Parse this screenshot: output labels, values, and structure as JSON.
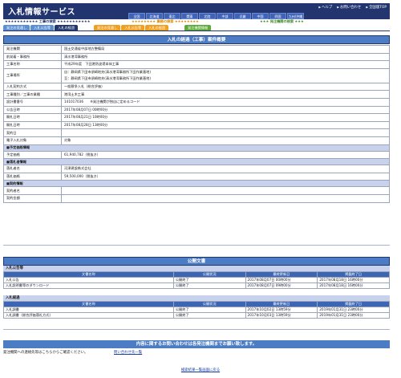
{
  "header": {
    "title": "入札情報サービス",
    "links": [
      "ヘルプ",
      "お問い合わせ",
      "全国版TOP"
    ],
    "regions": [
      "全国",
      "北海道",
      "東北",
      "関東",
      "北陸",
      "中部",
      "近畿",
      "中国",
      "四国",
      "九州/沖縄"
    ]
  },
  "categories": {
    "construction": "★★★★★★★★★★★ 工事の検索 ★★★★★★★★★★★",
    "services": "★★★★★★★★ 業務の検索 ★★★★★★★★",
    "client": "★★★ 発注機関の検索 ★★★"
  },
  "tabs": [
    "発注の見通し",
    "入札公告等",
    "入札の経過",
    "発注の見通し",
    "入札公告等",
    "入札の経過",
    "発注機関情報"
  ],
  "detail": {
    "title": "入札の経過（工事）案件概要",
    "rows": [
      {
        "k": "発注機関",
        "v": "国土交通省中部地方整備局"
      },
      {
        "k": "前発着・事務所",
        "v": "清水港湾事務所"
      },
      {
        "k": "工事名称",
        "v": "平成29年度　下田港防波堤本体工事"
      },
      {
        "k": "工事場所",
        "v1": "自：静岡県下田市須崎地先(清水港湾事務所下田作業基地)",
        "v2": "至：静岡県下田市須崎地先(清水港湾事務所下田作業基地)"
      },
      {
        "k": "入札契約方式",
        "v": "一般競争入札（総合評価）"
      },
      {
        "k": "工事種別／工事の業種",
        "v": "港湾土木工事"
      },
      {
        "k": "設計書番号",
        "v": "141017036　　※発注機関が独自に定めるコード"
      },
      {
        "k": "公告日時",
        "v": "2017年08月07日 00時00分"
      },
      {
        "k": "開札日時",
        "v": "2017年08月21日 10時00分"
      },
      {
        "k": "開札日時",
        "v": "2017年08月28日 13時00分"
      },
      {
        "k": "契約日",
        "v": ""
      },
      {
        "k": "電子入札対象",
        "v": "対象"
      }
    ],
    "estimate_header": "■予定価格情報",
    "estimate": {
      "k": "予定価格",
      "v": "61,940,782（税抜き）"
    },
    "winner_header": "■落札者情報",
    "winner": [
      {
        "k": "落札者名",
        "v": "河津建設株式会社"
      },
      {
        "k": "落札価格",
        "v": "59,500,000（税抜き）"
      }
    ],
    "contract_header": "■契約情報",
    "contract": [
      {
        "k": "契約者名",
        "v": ""
      },
      {
        "k": "契約金額",
        "v": ""
      }
    ]
  },
  "documents": {
    "title": "公開文書",
    "sections": [
      {
        "label": "入札公告等",
        "headers": [
          "文書名称",
          "公開状況",
          "最終更新日",
          "掲載終了日"
        ],
        "rows": [
          [
            "入札公告",
            "公開終了",
            "2017年08月07日 00時00分",
            "2017年08月18日 16時00分"
          ],
          [
            "入札説明書等のダウンロード",
            "公開終了",
            "2017年08月07日 09時00分",
            "2017年08月18日 16時00分"
          ]
        ]
      },
      {
        "label": "入札経過",
        "headers": [
          "文書名称",
          "公開状況",
          "最終更新日",
          "掲載終了日"
        ],
        "rows": [
          [
            "入札調書",
            "公開終了",
            "2017年10月02日 13時59分",
            "2019年01月31日 23時00分"
          ],
          [
            "入札調書（総合評価落札方式）",
            "公開終了",
            "2017年10月03日 13時59分",
            "2019年01月31日 23時00分"
          ]
        ]
      }
    ]
  },
  "contact": {
    "bar": "内容に関するお問い合わせは各発注機関までお願い致します。",
    "text": "発注機関への連絡先等はこちらからご確認ください。",
    "link": "問い合わせ先一覧"
  },
  "back": "検索結果一覧画面に戻る",
  "colors": {
    "navy": "#23356e",
    "blue": "#4c7dc4",
    "orange": "#f0a020",
    "green": "#5cab3a",
    "light": "#c9d2ec"
  }
}
